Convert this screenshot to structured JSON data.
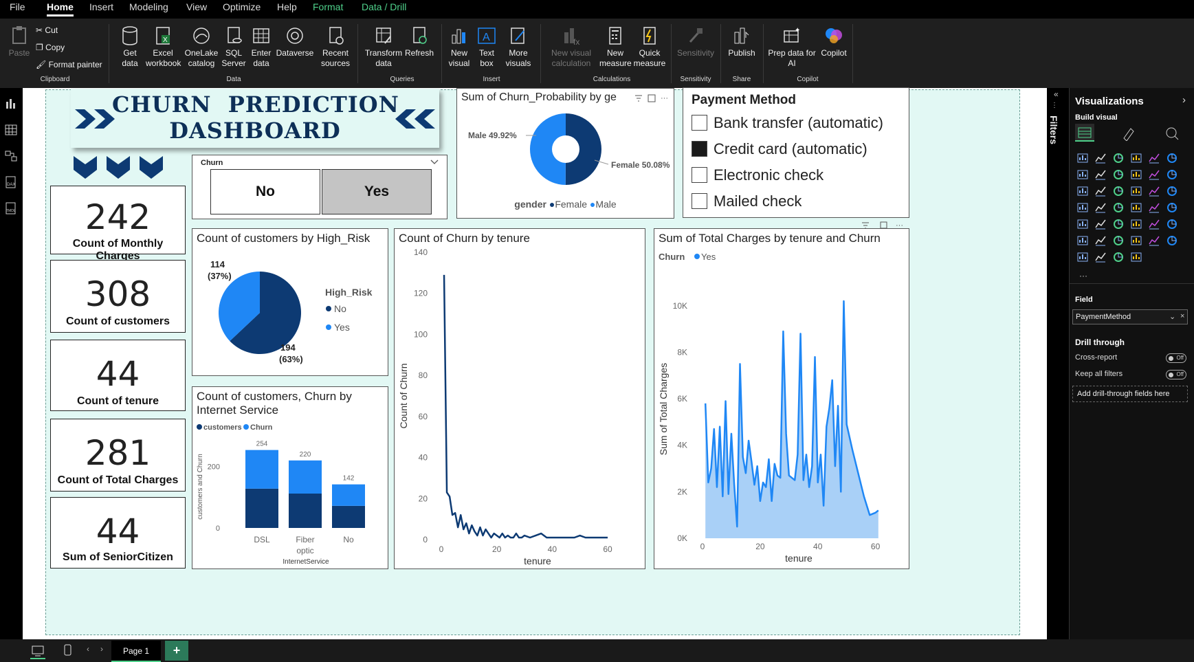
{
  "menu": {
    "items": [
      "File",
      "Home",
      "Insert",
      "Modeling",
      "View",
      "Optimize",
      "Help",
      "Format",
      "Data / Drill"
    ]
  },
  "ribbon": {
    "clipboard": {
      "paste": "Paste",
      "cut": "Cut",
      "copy": "Copy",
      "format_painter": "Format painter",
      "group": "Clipboard"
    },
    "data": {
      "get_data": "Get data",
      "excel": "Excel workbook",
      "onelake": "OneLake catalog",
      "sql": "SQL Server",
      "enter": "Enter data",
      "dataverse": "Dataverse",
      "recent": "Recent sources",
      "group": "Data"
    },
    "queries": {
      "transform": "Transform data",
      "refresh": "Refresh",
      "group": "Queries"
    },
    "insert": {
      "new_visual": "New visual",
      "text_box": "Text box",
      "more_visuals": "More visuals",
      "group": "Insert"
    },
    "calculations": {
      "new_visual_calc": "New visual calculation",
      "new_measure": "New measure",
      "quick_measure": "Quick measure",
      "group": "Calculations"
    },
    "sensitivity": {
      "label": "Sensitivity",
      "group": "Sensitivity"
    },
    "share": {
      "publish": "Publish",
      "group": "Share"
    },
    "copilot": {
      "prep": "Prep data for AI",
      "copilot": "Copilot",
      "group": "Copilot"
    }
  },
  "title": {
    "line1": "CHURN  PREDICTION",
    "line2": "DASHBOARD"
  },
  "kpis": [
    {
      "value": "242",
      "label": "Count of Monthly Charges"
    },
    {
      "value": "308",
      "label": "Count of customers"
    },
    {
      "value": "44",
      "label": "Count of tenure"
    },
    {
      "value": "281",
      "label": "Count of Total Charges"
    },
    {
      "value": "44",
      "label": "Sum of SeniorCitizen"
    }
  ],
  "slicer": {
    "title": "Churn",
    "options": [
      "No",
      "Yes"
    ],
    "selected": "Yes"
  },
  "payment": {
    "title": "Payment Method",
    "options": [
      {
        "label": "Bank transfer (automatic)",
        "checked": false
      },
      {
        "label": "Credit card (automatic)",
        "checked": true
      },
      {
        "label": "Electronic check",
        "checked": false
      },
      {
        "label": "Mailed check",
        "checked": false
      }
    ]
  },
  "colors": {
    "dark": "#0d3a73",
    "light": "#1f87f5",
    "area": "#a9d0f7",
    "accent": "#4fd18b",
    "teal_bg": "#e2f8f4"
  },
  "chart_data": [
    {
      "type": "pie",
      "title": "Sum of Churn_Probability by ge",
      "legend_title": "gender",
      "labels": [
        "Female",
        "Male"
      ],
      "values": [
        50.08,
        49.92
      ],
      "label_text": [
        "Female 50.08%",
        "Male 49.92%"
      ],
      "donut": true
    },
    {
      "type": "pie",
      "title": "Count of customers by High_Risk",
      "legend_title": "High_Risk",
      "labels": [
        "No",
        "Yes"
      ],
      "values": [
        194,
        114
      ],
      "label_text": [
        "194",
        "114"
      ],
      "pct_text": [
        "(63%)",
        "(37%)"
      ]
    },
    {
      "type": "bar",
      "title": "Count of customers, Churn by Internet Service",
      "stacked": true,
      "categories": [
        "DSL",
        "Fiber optic",
        "No"
      ],
      "series": [
        {
          "name": "customers",
          "values": [
            128,
            112,
            72
          ]
        },
        {
          "name": "Churn",
          "values": [
            126,
            108,
            70
          ]
        }
      ],
      "totals": [
        254,
        220,
        142
      ],
      "xlabel": "InternetService",
      "ylabel": "customers and Churn",
      "ylim": [
        0,
        280
      ],
      "yticks": [
        0,
        200
      ]
    },
    {
      "type": "line",
      "title": "Count of Churn by tenure",
      "xlabel": "tenure",
      "ylabel": "Count of Churn",
      "xlim": [
        0,
        60
      ],
      "ylim": [
        0,
        140
      ],
      "xticks": [
        0,
        20,
        40,
        60
      ],
      "yticks": [
        0,
        20,
        40,
        60,
        80,
        100,
        120,
        140
      ],
      "x": [
        1,
        2,
        3,
        4,
        5,
        6,
        7,
        8,
        9,
        10,
        11,
        12,
        13,
        14,
        15,
        16,
        17,
        18,
        19,
        20,
        21,
        22,
        23,
        24,
        25,
        26,
        27,
        28,
        29,
        30,
        32,
        34,
        36,
        38,
        40,
        42,
        44,
        46,
        48,
        50,
        52,
        54,
        56,
        58,
        60
      ],
      "y": [
        129,
        23,
        21,
        12,
        13,
        6,
        12,
        5,
        8,
        3,
        7,
        4,
        2,
        6,
        2,
        5,
        3,
        1,
        3,
        2,
        1,
        3,
        1,
        2,
        1,
        1,
        3,
        1,
        1,
        2,
        1,
        2,
        3,
        1,
        1,
        1,
        1,
        1,
        1,
        2,
        1,
        1,
        1,
        1,
        1
      ]
    },
    {
      "type": "area",
      "title": "Sum of Total Charges by tenure and Churn",
      "legend_title": "Churn",
      "series_name": "Yes",
      "xlabel": "tenure",
      "ylabel": "Sum of Total Charges",
      "xlim": [
        0,
        62
      ],
      "ylim": [
        0,
        11000
      ],
      "xticks": [
        0,
        20,
        40,
        60
      ],
      "yticks": [
        "0K",
        "2K",
        "4K",
        "6K",
        "8K",
        "10K"
      ],
      "x": [
        1,
        2,
        3,
        4,
        5,
        6,
        7,
        8,
        9,
        10,
        11,
        12,
        13,
        14,
        15,
        16,
        17,
        18,
        19,
        20,
        21,
        22,
        23,
        24,
        25,
        26,
        27,
        28,
        29,
        30,
        31,
        32,
        33,
        34,
        35,
        36,
        37,
        38,
        39,
        40,
        41,
        42,
        43,
        44,
        45,
        46,
        47,
        48,
        49,
        50,
        52,
        54,
        56,
        58,
        60,
        61
      ],
      "y": [
        5800,
        2400,
        3000,
        4700,
        2200,
        4800,
        1800,
        5900,
        1900,
        4500,
        2300,
        500,
        7500,
        3500,
        2800,
        4200,
        3300,
        2300,
        3100,
        1600,
        2400,
        2200,
        3400,
        1600,
        3200,
        2700,
        2600,
        8900,
        4500,
        2700,
        2600,
        2500,
        3600,
        8800,
        2500,
        3600,
        2200,
        3100,
        7800,
        2400,
        3600,
        1400,
        4800,
        5600,
        6800,
        3100,
        5700,
        2000,
        10200,
        4900,
        3800,
        2800,
        1800,
        1000,
        1100,
        1200
      ]
    }
  ],
  "filters_label": "Filters",
  "viz_pane": {
    "title": "Visualizations",
    "build": "Build visual",
    "field_label": "Field",
    "field_value": "PaymentMethod",
    "drill": "Drill through",
    "cross_report": "Cross-report",
    "keep_filters": "Keep all filters",
    "toggle_off": "Off",
    "add_drill": "Add drill-through fields here"
  },
  "page_tab": "Page 1"
}
